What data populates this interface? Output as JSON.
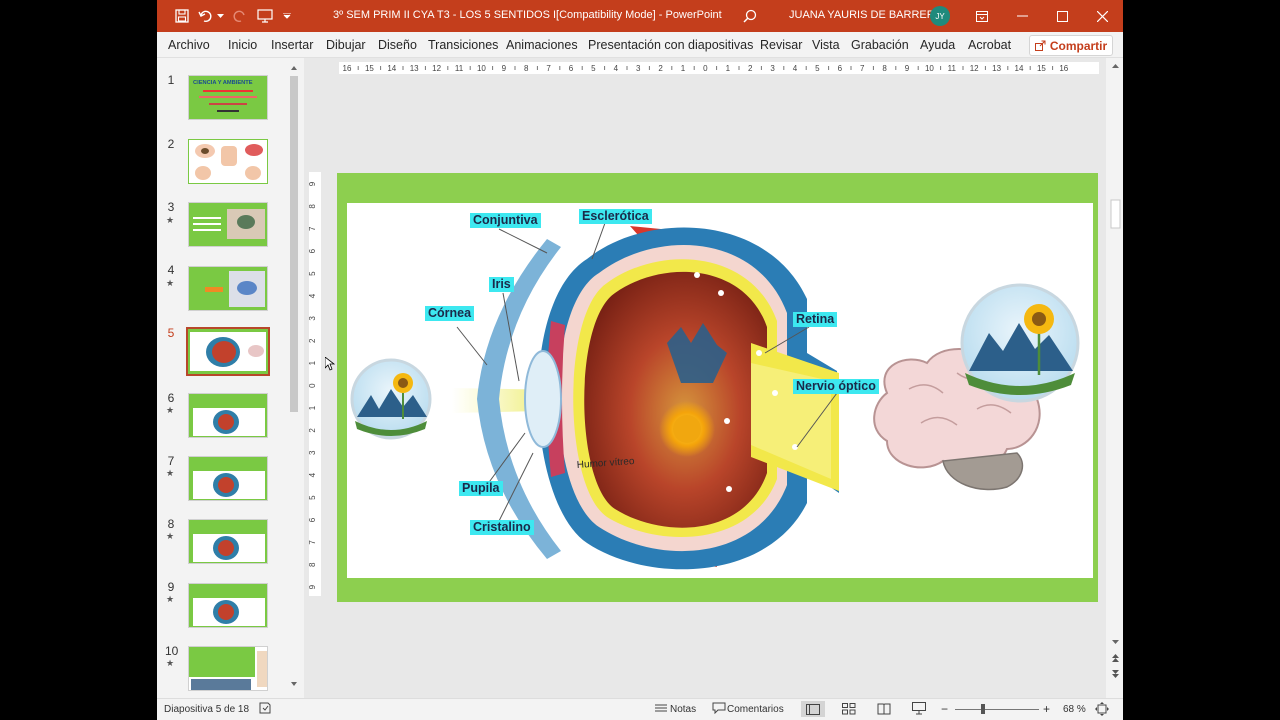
{
  "titlebar": {
    "doc_title": "3º SEM PRIM II CYA T3 - LOS 5 SENTIDOS I[Compatibility Mode]  -  PowerPoint",
    "user_name": "JUANA YAURIS DE BARRERA",
    "avatar_initials": "JY",
    "accent": "#c43e1c"
  },
  "menu": {
    "items": [
      "Archivo",
      "Inicio",
      "Insertar",
      "Dibujar",
      "Diseño",
      "Transiciones",
      "Animaciones",
      "Presentación con diapositivas",
      "Revisar",
      "Vista",
      "Grabación",
      "Ayuda",
      "Acrobat"
    ],
    "share": "Compartir"
  },
  "thumbnails": {
    "numbers": [
      "1",
      "2",
      "3",
      "4",
      "5",
      "6",
      "7",
      "8",
      "9",
      "10"
    ],
    "star": "★",
    "title1": "CIENCIA Y AMBIENTE",
    "selected": 5
  },
  "ruler": {
    "h_ticks": [
      "16",
      "15",
      "14",
      "13",
      "12",
      "11",
      "10",
      "9",
      "8",
      "7",
      "6",
      "5",
      "4",
      "3",
      "2",
      "1",
      "0",
      "1",
      "2",
      "3",
      "4",
      "5",
      "6",
      "7",
      "8",
      "9",
      "10",
      "11",
      "12",
      "13",
      "14",
      "15",
      "16"
    ],
    "v_ticks": [
      "9",
      "8",
      "7",
      "6",
      "5",
      "4",
      "3",
      "2",
      "1",
      "0",
      "1",
      "2",
      "3",
      "4",
      "5",
      "6",
      "7",
      "8",
      "9"
    ]
  },
  "slide": {
    "labels": {
      "conjuntiva": "Conjuntiva",
      "esclerotica": "Esclerótica",
      "iris": "Iris",
      "cornea": "Córnea",
      "retina": "Retina",
      "nervio": "Nervio óptico",
      "pupila": "Pupila",
      "cristalino": "Cristalino",
      "humor": "Humor vítreo"
    }
  },
  "status": {
    "slide_info": "Diapositiva 5 de 18",
    "notes": "Notas",
    "comments": "Comentarios",
    "zoom": "68 %"
  }
}
